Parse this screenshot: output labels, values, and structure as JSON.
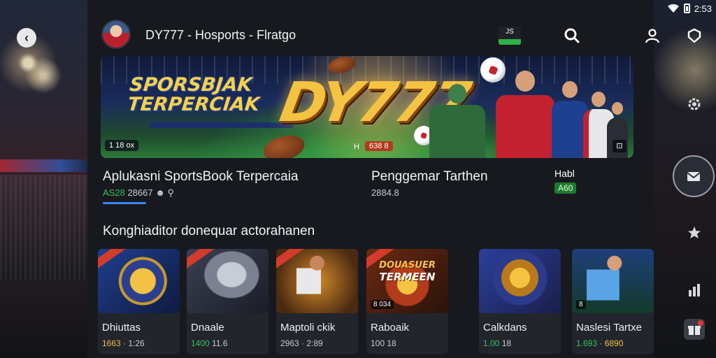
{
  "status_bar": {
    "time": "2:53"
  },
  "header": {
    "title": "DY777 - Hosports - Flratgo",
    "badge_text": "JS"
  },
  "banner": {
    "tagline_line1": "SPORSBJAK",
    "tagline_line2": "TERPERCIAK",
    "logo_text": "DY777",
    "chip_left": "1 18 ox",
    "chip_mid": "638 8",
    "chip_mid_icon": "H"
  },
  "featured": {
    "title": "Aplukasni SportsBook Terpercaia",
    "meta_green": "AS28",
    "meta_rest": " 28667",
    "underline_active": true
  },
  "secondary": {
    "title": "Penggemar Tarthen",
    "meta": "2884.8"
  },
  "mini_stat": {
    "label": "Habl",
    "value": "A60"
  },
  "list_heading": "Konghiaditor donequar actorahanen",
  "games": [
    {
      "name": "Dhiuttas",
      "stat_hl": "1663",
      "stat_rest": " · 1:26",
      "stat_color": "yellow",
      "badge": ""
    },
    {
      "name": "Dnaale",
      "stat_hl": "1400",
      "stat_rest": "  11.6",
      "stat_color": "green",
      "badge": ""
    },
    {
      "name": "Maptoli ckik",
      "stat_hl": "",
      "stat_rest": "2963 · 2:89",
      "stat_color": "none",
      "badge": ""
    },
    {
      "name": "Raboaik",
      "stat_hl": "",
      "stat_rest": "100  18",
      "stat_color": "none",
      "badge": "8 034"
    },
    {
      "name": "Calkdans",
      "stat_hl": "1.00",
      "stat_rest": "  18",
      "stat_color": "green",
      "badge": ""
    },
    {
      "name": "Naslesi Tartxe",
      "stat_hl": "1.693",
      "stat_rest": " · 6890",
      "stat_color": "greenyellow",
      "badge": "8"
    }
  ],
  "game_card_titles": {
    "card4_line1": "DOUASUER",
    "card4_line2": "TERMEEN"
  },
  "icons": {
    "back": "chevron-left-icon",
    "search": "search-icon",
    "profile": "user-icon",
    "support": "headset-icon",
    "settings": "gear-icon",
    "mail": "mail-icon",
    "favorites": "star-icon",
    "stats": "bar-chart-icon",
    "gifts": "gift-icon"
  },
  "colors": {
    "accent_blue": "#3d86ff",
    "accent_green": "#35c25a",
    "gold": "#f5c342",
    "panel": "#17191f"
  }
}
